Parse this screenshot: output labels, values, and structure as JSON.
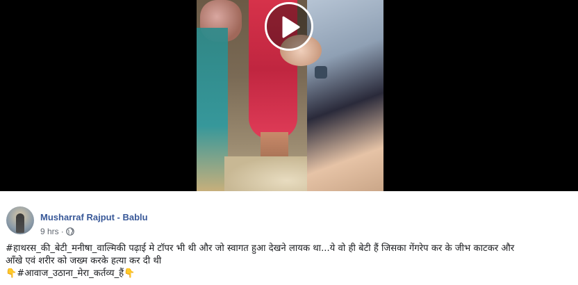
{
  "video": {
    "play_icon": "play-icon",
    "colors": {
      "background": "#000000",
      "play_border": "#ffffff"
    }
  },
  "post": {
    "author": "Musharraf Rajput - Bablu",
    "time": "9 hrs",
    "separator": "·",
    "privacy_icon": "globe-icon",
    "text_line_1": "#हाथरस_की_बेटी_मनीषा_वाल्मिकी पढ़ाई मे टॉपर भी थी और जो स्वागत हुआ देखने लायक था...ये वो ही बेटी हैं जिसका गेंगरेप कर के जीभ काटकर और",
    "text_line_2": "आँखे एवं शरीर को जख्म करके हत्या कर दी थी",
    "text_line_3_emoji_left": "👇",
    "text_line_3": "#आवाज_उठाना_मेरा_कर्तव्य_हैं",
    "text_line_3_emoji_right": "👇",
    "colors": {
      "author": "#385898",
      "meta": "#606770",
      "text": "#1c1e21"
    }
  }
}
